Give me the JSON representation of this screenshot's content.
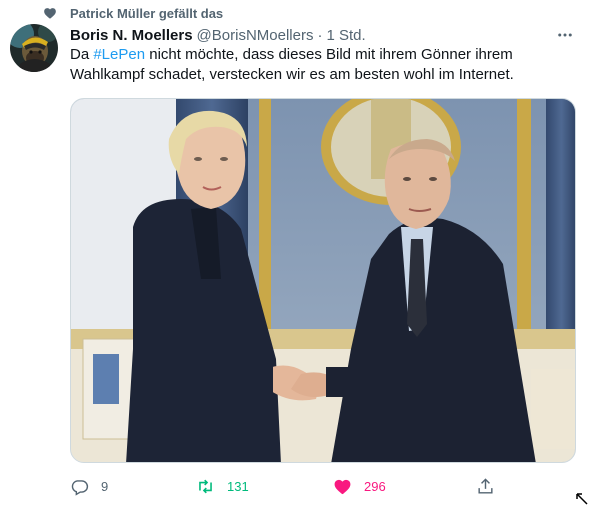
{
  "social_context": {
    "text": "Patrick Müller gefällt das",
    "icon": "heart-icon"
  },
  "tweet": {
    "display_name": "Boris N. Moellers",
    "handle": "@BorisNMoellers",
    "separator": "·",
    "time": "1 Std.",
    "more_icon": "more-horizontal-icon",
    "text_before": "Da ",
    "hashtag": "#LePen",
    "text_after": " nicht möchte, dass dieses Bild mit ihrem Gönner ihrem Wahlkampf schadet, verstecken wir es am besten wohl im Internet."
  },
  "actions": {
    "reply_count": "9",
    "retweet_count": "131",
    "like_count": "296",
    "reply_icon": "reply-icon",
    "retweet_icon": "retweet-icon",
    "like_icon": "heart-filled-icon",
    "share_icon": "share-icon"
  },
  "colors": {
    "link": "#1d9bf0",
    "muted": "#536471",
    "retweeted": "#00ba7c",
    "liked": "#f91880"
  }
}
